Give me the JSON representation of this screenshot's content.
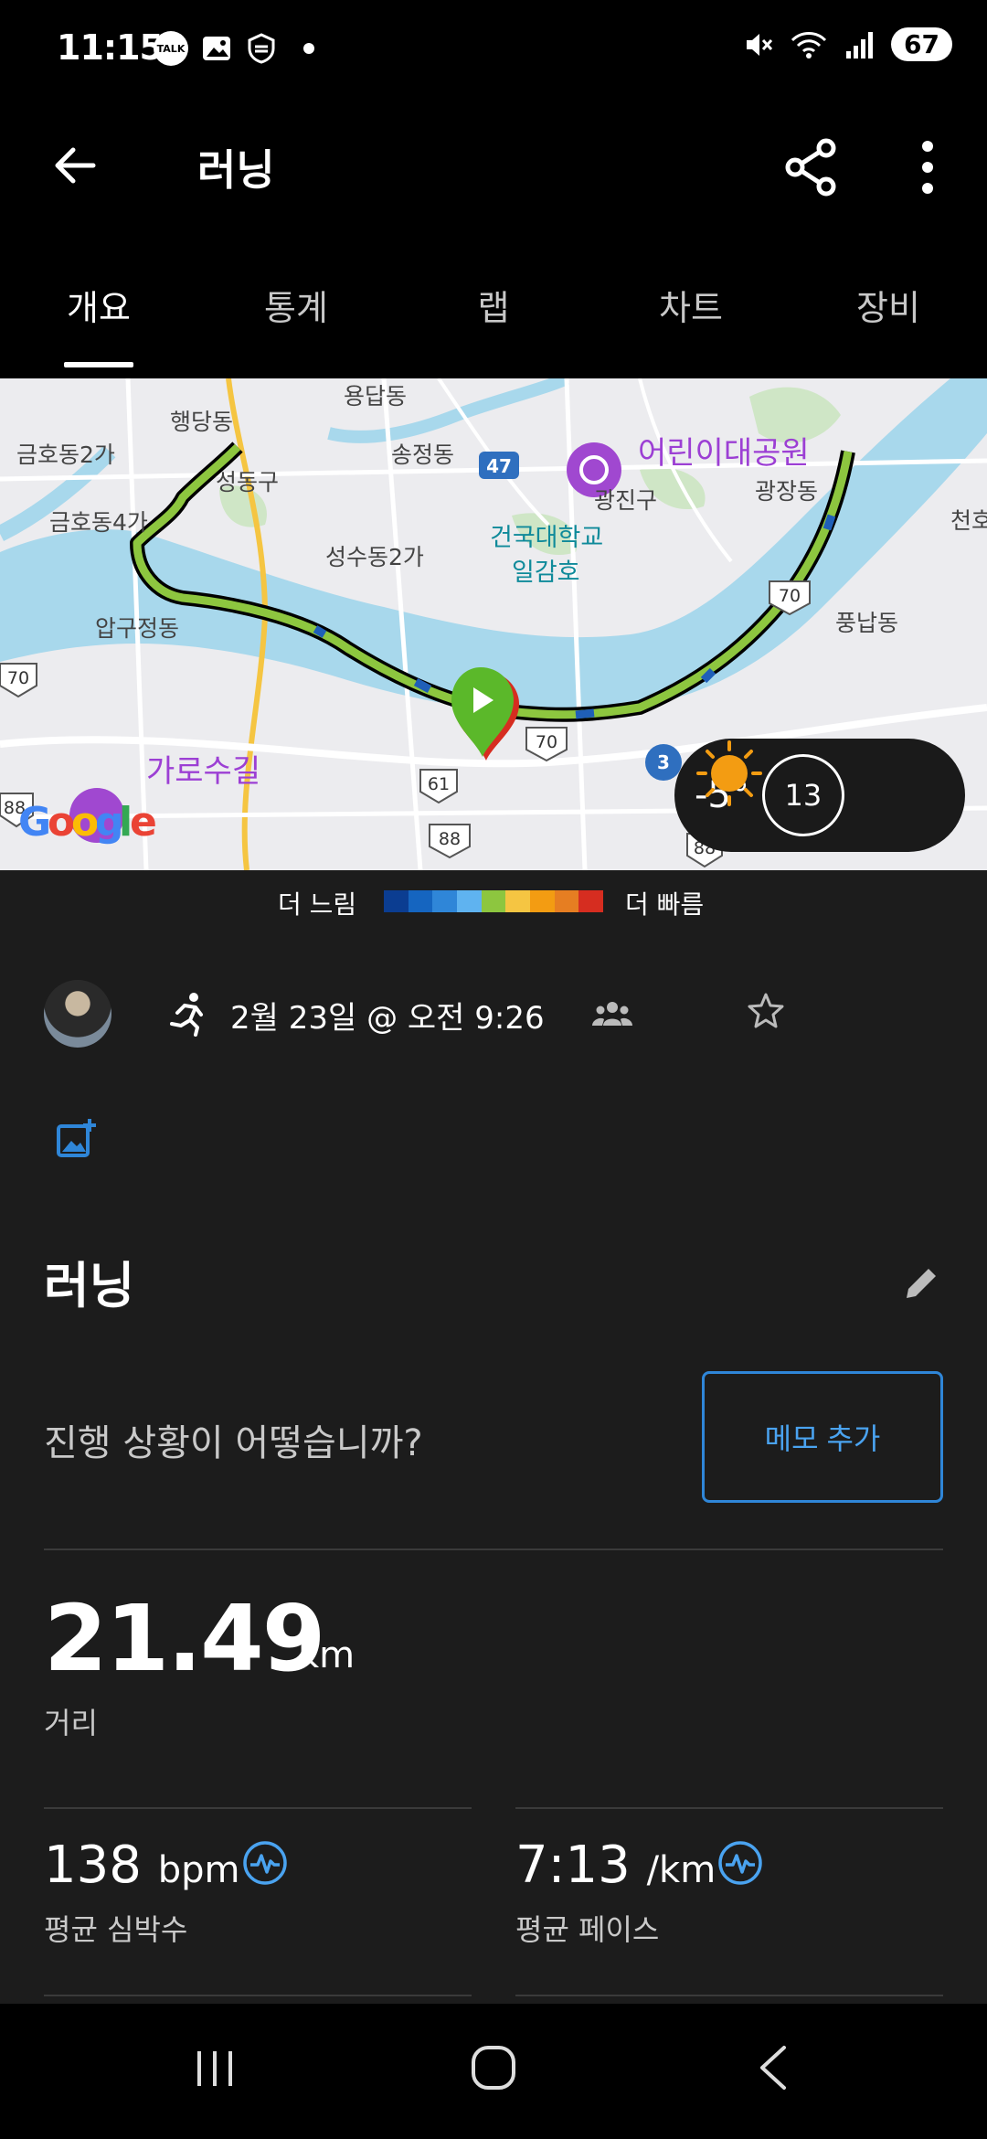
{
  "status_bar": {
    "time": "11:15",
    "talk_icon_label": "TALK",
    "battery": "67",
    "icons": [
      "kakaotalk-icon",
      "gallery-icon",
      "shield-icon",
      "mute-icon",
      "wifi-icon",
      "signal-icon",
      "battery-icon"
    ]
  },
  "app_bar": {
    "title": "러닝"
  },
  "tabs": [
    {
      "label": "개요",
      "active": true
    },
    {
      "label": "통계",
      "active": false
    },
    {
      "label": "랩",
      "active": false
    },
    {
      "label": "차트",
      "active": false
    },
    {
      "label": "장비",
      "active": false
    }
  ],
  "map": {
    "labels": [
      "용답동",
      "행당동",
      "금호동2가",
      "성동구",
      "송정동",
      "금호동4가",
      "성수동2가",
      "건국대학교",
      "일감호",
      "광진구",
      "광장동",
      "천호",
      "풍납동",
      "압구정동",
      "가로수길",
      "어린이대공원"
    ],
    "road_numbers": [
      "47",
      "70",
      "70",
      "70",
      "3",
      "61",
      "88",
      "88",
      "88"
    ],
    "weather": {
      "temperature": "-5°",
      "wind": "13",
      "icon": "sun-icon"
    },
    "brand": "Google",
    "colors": {
      "water": "#a8d8ec",
      "route_fast": "#8dc63f",
      "route_slow": "#1f5fb8",
      "marker": "#5bb82a"
    }
  },
  "legend": {
    "slow_label": "더 느림",
    "fast_label": "더 빠름",
    "colors": [
      "#0b3d91",
      "#1565c0",
      "#2f86d8",
      "#5fb3f0",
      "#8dc63f",
      "#f5c542",
      "#f39c12",
      "#e67e22",
      "#d62d20"
    ]
  },
  "activity": {
    "date": "2월 23일 @ 오전 9:26",
    "name": "러닝",
    "prompt": "진행 상황이 어떻습니까?",
    "memo_button": "메모 추가"
  },
  "stats": {
    "distance": {
      "value": "21.49",
      "unit": "km",
      "label": "거리"
    },
    "heart_rate": {
      "value": "138",
      "unit": "bpm",
      "label": "평균 심박수"
    },
    "pace": {
      "value": "7:13",
      "unit": "/km",
      "label": "평균 페이스"
    }
  }
}
